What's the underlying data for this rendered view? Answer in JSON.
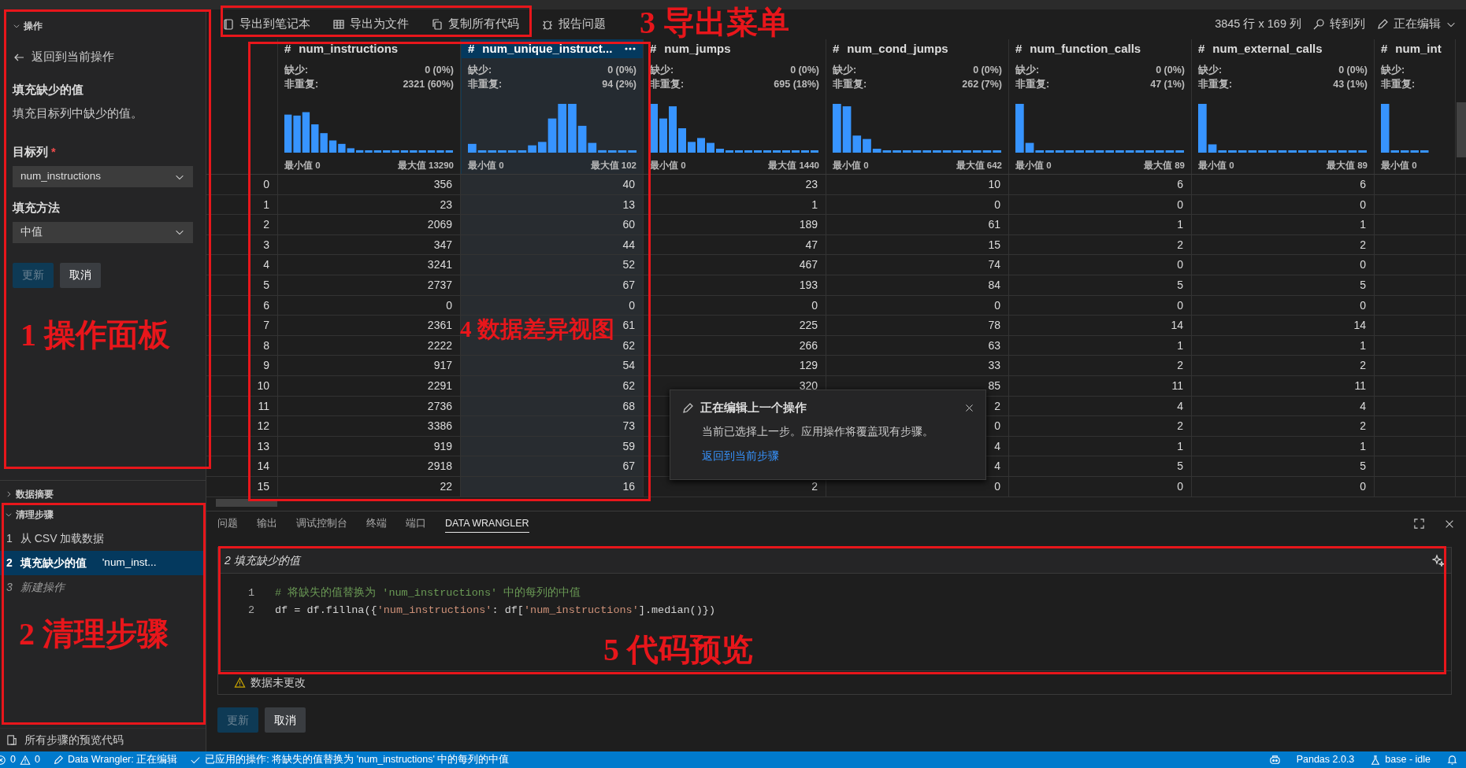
{
  "sidebar": {
    "operation_panel": {
      "header": "操作",
      "expanded": true,
      "back_link": "返回到当前操作",
      "title": "填充缺少的值",
      "description": "填充目标列中缺少的值。",
      "fields": [
        {
          "label": "目标列",
          "required_mark": "*",
          "value": "num_instructions"
        },
        {
          "label": "填充方法",
          "value": "中值"
        }
      ],
      "buttons": [
        {
          "label": "更新",
          "disabled": true
        },
        {
          "label": "取消",
          "disabled": false
        }
      ]
    },
    "sections": [
      {
        "label": "数据摘要",
        "expanded": false
      },
      {
        "label": "清理步骤",
        "expanded": true
      }
    ],
    "steps": [
      {
        "number": "1",
        "label": "从 CSV 加载数据",
        "kind": "done",
        "selected": false
      },
      {
        "number": "2",
        "label": "填充缺少的值",
        "detail": "'num_inst...",
        "kind": "done",
        "selected": true
      },
      {
        "number": "3",
        "label": "新建操作",
        "kind": "new",
        "selected": false
      }
    ],
    "footer": "所有步骤的预览代码"
  },
  "toolbar": {
    "actions": [
      {
        "label": "导出到笔记本",
        "kind": "notebook"
      },
      {
        "label": "导出为文件",
        "kind": "file"
      },
      {
        "label": "复制所有代码",
        "kind": "copy"
      },
      {
        "label": "报告问题",
        "kind": "bug"
      }
    ],
    "dimensions": "3845 行 x 169 列",
    "goto": "转到列",
    "mode": "正在编辑"
  },
  "table": {
    "columns": [
      {
        "type_mark": "#",
        "name": "num_instructions",
        "selected": false,
        "missing_label": "缺少:",
        "missing": "0 (0%)",
        "distinct_label": "非重复:",
        "distinct": "2321 (60%)",
        "min": "最小值 0",
        "max": "最大值 13290"
      },
      {
        "type_mark": "#",
        "name": "num_unique_instruct...",
        "selected": true,
        "missing_label": "缺少:",
        "missing": "0 (0%)",
        "distinct_label": "非重复:",
        "distinct": "94 (2%)",
        "min": "最小值 0",
        "max": "最大值 102"
      },
      {
        "type_mark": "#",
        "name": "num_jumps",
        "selected": false,
        "missing_label": "缺少:",
        "missing": "0 (0%)",
        "distinct_label": "非重复:",
        "distinct": "695 (18%)",
        "min": "最小值 0",
        "max": "最大值 1440"
      },
      {
        "type_mark": "#",
        "name": "num_cond_jumps",
        "selected": false,
        "missing_label": "缺少:",
        "missing": "0 (0%)",
        "distinct_label": "非重复:",
        "distinct": "262 (7%)",
        "min": "最小值 0",
        "max": "最大值 642"
      },
      {
        "type_mark": "#",
        "name": "num_function_calls",
        "selected": false,
        "missing_label": "缺少:",
        "missing": "0 (0%)",
        "distinct_label": "非重复:",
        "distinct": "47 (1%)",
        "min": "最小值 0",
        "max": "最大值 89"
      },
      {
        "type_mark": "#",
        "name": "num_external_calls",
        "selected": false,
        "missing_label": "缺少:",
        "missing": "0 (0%)",
        "distinct_label": "非重复:",
        "distinct": "43 (1%)",
        "min": "最小值 0",
        "max": "最大值 89"
      },
      {
        "type_mark": "#",
        "name": "num_int",
        "selected": false,
        "missing_label": "缺少:",
        "distinct_label": "非重复:",
        "min": "最小值 0"
      }
    ],
    "rows": [
      {
        "index": "0",
        "cells": [
          "356",
          "40",
          "23",
          "10",
          "6",
          "6"
        ]
      },
      {
        "index": "1",
        "cells": [
          "23",
          "13",
          "1",
          "0",
          "0",
          "0"
        ]
      },
      {
        "index": "2",
        "cells": [
          "2069",
          "60",
          "189",
          "61",
          "1",
          "1"
        ]
      },
      {
        "index": "3",
        "cells": [
          "347",
          "44",
          "47",
          "15",
          "2",
          "2"
        ]
      },
      {
        "index": "4",
        "cells": [
          "3241",
          "52",
          "467",
          "74",
          "0",
          "0"
        ]
      },
      {
        "index": "5",
        "cells": [
          "2737",
          "67",
          "193",
          "84",
          "5",
          "5"
        ]
      },
      {
        "index": "6",
        "cells": [
          "0",
          "0",
          "0",
          "0",
          "0",
          "0"
        ]
      },
      {
        "index": "7",
        "cells": [
          "2361",
          "61",
          "225",
          "78",
          "14",
          "14"
        ]
      },
      {
        "index": "8",
        "cells": [
          "2222",
          "62",
          "266",
          "63",
          "1",
          "1"
        ]
      },
      {
        "index": "9",
        "cells": [
          "917",
          "54",
          "129",
          "33",
          "2",
          "2"
        ]
      },
      {
        "index": "10",
        "cells": [
          "2291",
          "62",
          "320",
          "85",
          "11",
          "11"
        ]
      },
      {
        "index": "11",
        "cells": [
          "2736",
          "68",
          null,
          "2",
          "4",
          "4"
        ]
      },
      {
        "index": "12",
        "cells": [
          "3386",
          "73",
          null,
          "0",
          "2",
          "2"
        ]
      },
      {
        "index": "13",
        "cells": [
          "919",
          "59",
          null,
          "4",
          "1",
          "1"
        ]
      },
      {
        "index": "14",
        "cells": [
          "2918",
          "67",
          null,
          "4",
          "5",
          "5"
        ]
      },
      {
        "index": "15",
        "cells": [
          "22",
          "16",
          "2",
          "0",
          "0",
          "0"
        ]
      }
    ]
  },
  "popup": {
    "title": "正在编辑上一个操作",
    "message": "当前已选择上一步。应用操作将覆盖现有步骤。",
    "link": "返回到当前步骤"
  },
  "panel": {
    "tabs": [
      {
        "label": "问题",
        "selected": false
      },
      {
        "label": "输出",
        "selected": false
      },
      {
        "label": "调试控制台",
        "selected": false
      },
      {
        "label": "终端",
        "selected": false
      },
      {
        "label": "端口",
        "selected": false
      },
      {
        "label": "DATA WRANGLER",
        "selected": true
      }
    ],
    "preview": {
      "step": "2",
      "title": "填充缺少的值",
      "lines": [
        {
          "number": "1",
          "tokens": [
            {
              "kind": "comment",
              "text": "# 将缺失的值替换为 'num_instructions' 中的每列的中值"
            }
          ]
        },
        {
          "number": "2",
          "tokens": [
            {
              "kind": "plain",
              "text": "df = df.fillna({"
            },
            {
              "kind": "string",
              "text": "'num_instructions'"
            },
            {
              "kind": "plain",
              "text": ": df["
            },
            {
              "kind": "string",
              "text": "'num_instructions'"
            },
            {
              "kind": "plain",
              "text": "].median()})"
            }
          ]
        }
      ]
    },
    "warning": "数据未更改",
    "buttons": [
      {
        "label": "更新",
        "disabled": true
      },
      {
        "label": "取消",
        "disabled": false
      }
    ]
  },
  "status_bar": {
    "left": [
      {
        "kind": "problems",
        "errors": "0",
        "warnings": "0"
      },
      {
        "kind": "edit",
        "text": "Data Wrangler: 正在编辑"
      },
      {
        "kind": "applied",
        "text": "已应用的操作: 将缺失的值替换为 'num_instructions' 中的每列的中值"
      }
    ],
    "right": [
      {
        "kind": "copilot"
      },
      {
        "kind": "text",
        "text": "Pandas 2.0.3"
      },
      {
        "kind": "env",
        "text": "base - idle"
      },
      {
        "kind": "bell"
      }
    ]
  },
  "annotations": [
    {
      "label": "1 操作面板"
    },
    {
      "label": "2 清理步骤"
    },
    {
      "label": "3 导出菜单"
    },
    {
      "label": "4 数据差异视图"
    },
    {
      "label": "5 代码预览"
    }
  ]
}
